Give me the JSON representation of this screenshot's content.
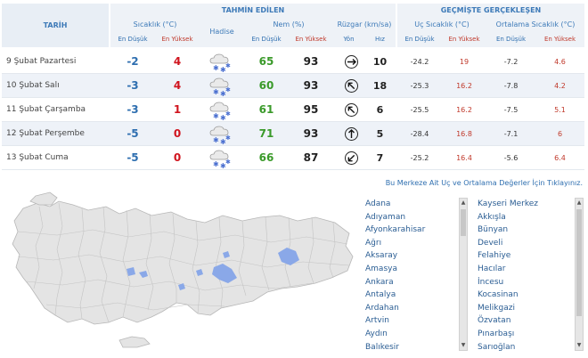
{
  "header": {
    "tarih": "TARİH",
    "tahmin": "TAHMİN EDİLEN",
    "gecmiste": "GEÇMİŞTE GERÇEKLEŞEN",
    "sicaklik": "Sıcaklık (°C)",
    "hadise": "Hadise",
    "nem": "Nem (%)",
    "ruzgar": "Rüzgar (km/sa)",
    "uc": "Uç Sıcaklık (°C)",
    "ortalama": "Ortalama Sıcaklık (°C)",
    "en_dusuk": "En Düşük",
    "en_yuksek": "En Yüksek",
    "yon": "Yön",
    "hiz": "Hız"
  },
  "rows": [
    {
      "day": "9 Şubat Pazartesi",
      "t_min": "-2",
      "t_max": "4",
      "nem_min": "65",
      "nem_max": "93",
      "wind_dir": "east",
      "wind_rot": 90,
      "wind_speed": "10",
      "uc_min": "-24.2",
      "uc_max": "19",
      "ort_min": "-7.2",
      "ort_max": "4.6",
      "weather_icon": "snow-cloud-icon"
    },
    {
      "day": "10 Şubat Salı",
      "t_min": "-3",
      "t_max": "4",
      "nem_min": "60",
      "nem_max": "93",
      "wind_dir": "north-west",
      "wind_rot": -45,
      "wind_speed": "18",
      "uc_min": "-25.3",
      "uc_max": "16.2",
      "ort_min": "-7.8",
      "ort_max": "4.2",
      "weather_icon": "snow-cloud-icon"
    },
    {
      "day": "11 Şubat Çarşamba",
      "t_min": "-3",
      "t_max": "1",
      "nem_min": "61",
      "nem_max": "95",
      "wind_dir": "north-west",
      "wind_rot": -45,
      "wind_speed": "6",
      "uc_min": "-25.5",
      "uc_max": "16.2",
      "ort_min": "-7.5",
      "ort_max": "5.1",
      "weather_icon": "snow-cloud-icon"
    },
    {
      "day": "12 Şubat Perşembe",
      "t_min": "-5",
      "t_max": "0",
      "nem_min": "71",
      "nem_max": "93",
      "wind_dir": "north",
      "wind_rot": 0,
      "wind_speed": "5",
      "uc_min": "-28.4",
      "uc_max": "16.8",
      "ort_min": "-7.1",
      "ort_max": "6",
      "weather_icon": "snow-cloud-icon"
    },
    {
      "day": "13 Şubat Cuma",
      "t_min": "-5",
      "t_max": "0",
      "nem_min": "66",
      "nem_max": "87",
      "wind_dir": "south-west",
      "wind_rot": -135,
      "wind_speed": "7",
      "uc_min": "-25.2",
      "uc_max": "16.4",
      "ort_min": "-5.6",
      "ort_max": "6.4",
      "weather_icon": "snow-cloud-icon"
    }
  ],
  "link_text": "Bu Merkeze Ait Uç ve Ortalama Değerler İçin Tıklayınız.",
  "provinces": [
    "Adana",
    "Adıyaman",
    "Afyonkarahisar",
    "Ağrı",
    "Aksaray",
    "Amasya",
    "Ankara",
    "Antalya",
    "Ardahan",
    "Artvin",
    "Aydın",
    "Balıkesir"
  ],
  "districts": [
    "Kayseri Merkez",
    "Akkışla",
    "Bünyan",
    "Develi",
    "Felahiye",
    "Hacılar",
    "İncesu",
    "Kocasinan",
    "Melikgazi",
    "Özvatan",
    "Pınarbaşı",
    "Sarıoğlan"
  ],
  "colors": {
    "header_blue": "#3d7ab8",
    "min_blue": "#2f6fb0",
    "max_red": "#d0141e",
    "nem_green": "#3a9a2a",
    "row_alt": "#eef2f8",
    "map_fill": "#e4e4e4",
    "lake": "#8aa8e8"
  }
}
